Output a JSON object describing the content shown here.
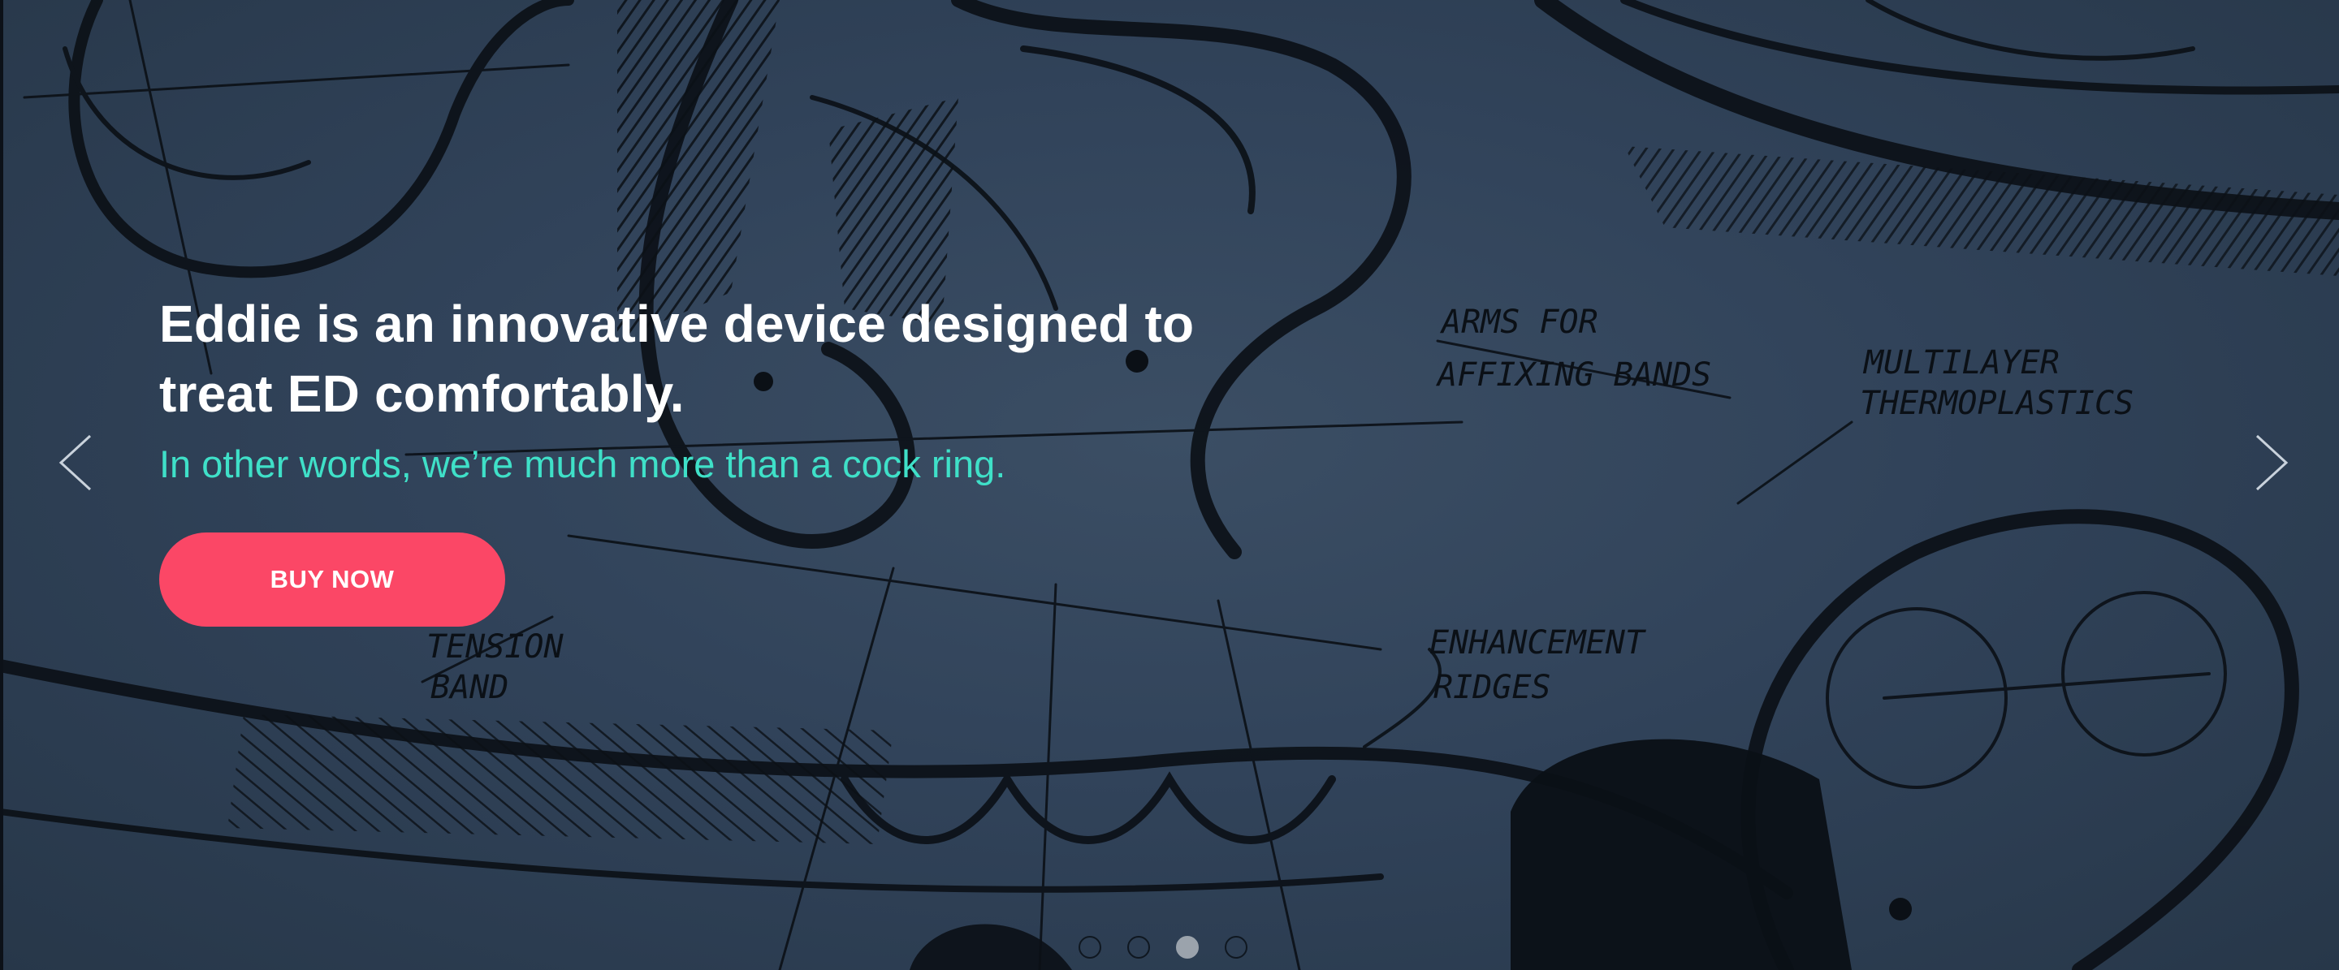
{
  "hero": {
    "headline": "Eddie is an innovative device designed to treat ED comfortably.",
    "subline": "In other words, we’re much more than a cock ring.",
    "cta_label": "BUY NOW",
    "background_labels": {
      "arms": [
        "ARMS FOR",
        "AFFIXING BANDS"
      ],
      "multilayer": [
        "MULTILAYER",
        "THERMOPLASTICS"
      ],
      "tension": [
        "TENSION",
        "BAND"
      ],
      "enhancement": [
        "ENHANCEMENT",
        "RIDGES"
      ]
    }
  },
  "carousel": {
    "prev_icon": "chevron-left-icon",
    "next_icon": "chevron-right-icon",
    "slide_count": 4,
    "active_slide": 3
  },
  "colors": {
    "background": "#31435a",
    "headline": "#ffffff",
    "subline": "#3fe0c8",
    "cta_background": "#fb4766",
    "cta_text": "#ffffff",
    "sketch_ink": "#0b1016"
  }
}
